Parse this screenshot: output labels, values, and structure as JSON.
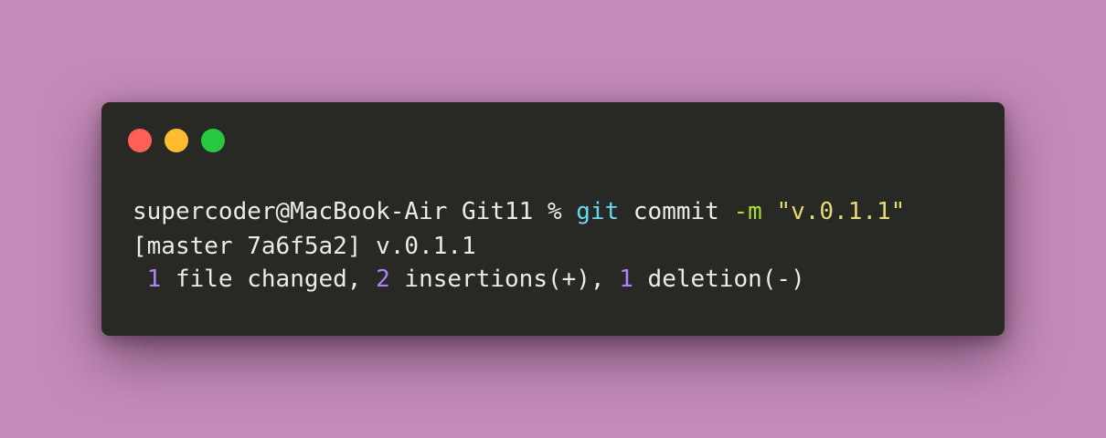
{
  "window": {
    "buttons": [
      {
        "name": "close",
        "color": "#fe5f57"
      },
      {
        "name": "minimize",
        "color": "#febc2e"
      },
      {
        "name": "zoom",
        "color": "#28c840"
      }
    ]
  },
  "colors": {
    "background": "#c48bb8",
    "terminal_bg": "#282824",
    "text": "#ecece6",
    "command": "#66d9ef",
    "flag": "#a6e22e",
    "string": "#e6db74",
    "number": "#ae81ff"
  },
  "terminal": {
    "prompt": "supercoder@MacBook-Air Git11 % ",
    "command": "git",
    "subcommand": " commit ",
    "flag": "-m",
    "space": " ",
    "message": "\"v.0.1.1\"",
    "output_line1": "[master 7a6f5a2] v.0.1.1",
    "stats": {
      "files_changed": "1",
      "files_changed_text": " file changed, ",
      "insertions": "2",
      "insertions_text": " insertions(+), ",
      "deletions": "1",
      "deletions_text": " deletion(-)"
    }
  }
}
